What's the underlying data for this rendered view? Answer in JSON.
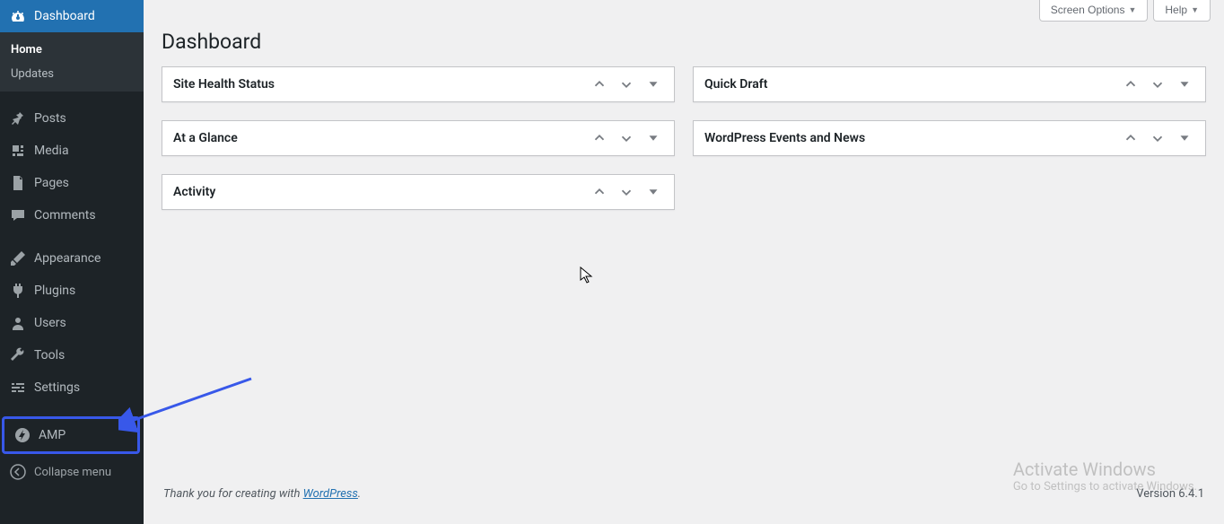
{
  "topbuttons": {
    "screen_options": "Screen Options",
    "help": "Help"
  },
  "page_title": "Dashboard",
  "sidebar": {
    "dashboard": "Dashboard",
    "sub_home": "Home",
    "sub_updates": "Updates",
    "posts": "Posts",
    "media": "Media",
    "pages": "Pages",
    "comments": "Comments",
    "appearance": "Appearance",
    "plugins": "Plugins",
    "users": "Users",
    "tools": "Tools",
    "settings": "Settings",
    "amp": "AMP",
    "collapse": "Collapse menu"
  },
  "widgets": {
    "site_health": "Site Health Status",
    "at_a_glance": "At a Glance",
    "activity": "Activity",
    "quick_draft": "Quick Draft",
    "events_news": "WordPress Events and News"
  },
  "footer": {
    "thanks_prefix": "Thank you for creating with ",
    "wordpress": "WordPress",
    "version": "Version 6.4.1"
  },
  "watermark": {
    "title": "Activate Windows",
    "subtitle": "Go to Settings to activate Windows."
  }
}
